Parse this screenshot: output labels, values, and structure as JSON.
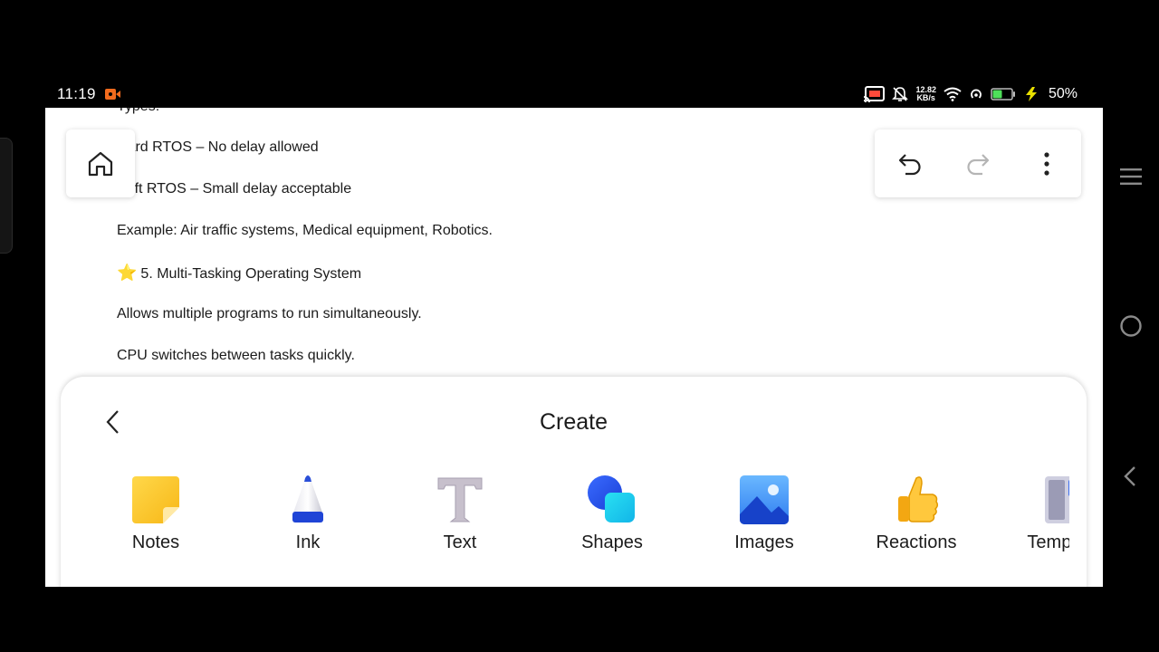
{
  "status_bar": {
    "time": "11:19",
    "net_speed_value": "12.82",
    "net_speed_unit": "KB/s",
    "battery_percent": "50%",
    "battery_level": 0.5,
    "rec_color": "#f26b1d",
    "battery_color": "#4ee05a"
  },
  "document": {
    "lines": [
      "Types:",
      "Hard RTOS – No delay allowed",
      "Soft RTOS – Small delay acceptable",
      "Example: Air traffic systems, Medical equipment, Robotics.",
      "5. Multi-Tasking Operating System",
      "Allows multiple programs to run simultaneously.",
      "CPU switches between tasks quickly."
    ],
    "heading_emoji": "⭐"
  },
  "toolbar": {
    "home_icon": "home-icon",
    "undo_icon": "undo-icon",
    "redo_icon": "redo-icon",
    "more_icon": "more-options-icon"
  },
  "create_panel": {
    "title": "Create",
    "back_icon": "chevron-left-icon",
    "items": [
      {
        "label": "Notes",
        "icon": "sticky-note-icon"
      },
      {
        "label": "Ink",
        "icon": "ink-pen-icon"
      },
      {
        "label": "Text",
        "icon": "text-icon"
      },
      {
        "label": "Shapes",
        "icon": "shapes-icon"
      },
      {
        "label": "Images",
        "icon": "image-icon"
      },
      {
        "label": "Reactions",
        "icon": "thumbs-up-icon"
      },
      {
        "label": "Templates",
        "icon": "template-icon"
      }
    ]
  },
  "nav_bar": {
    "menu_icon": "menu-icon",
    "home_icon": "circle-home-icon",
    "back_icon": "back-triangle-icon"
  }
}
